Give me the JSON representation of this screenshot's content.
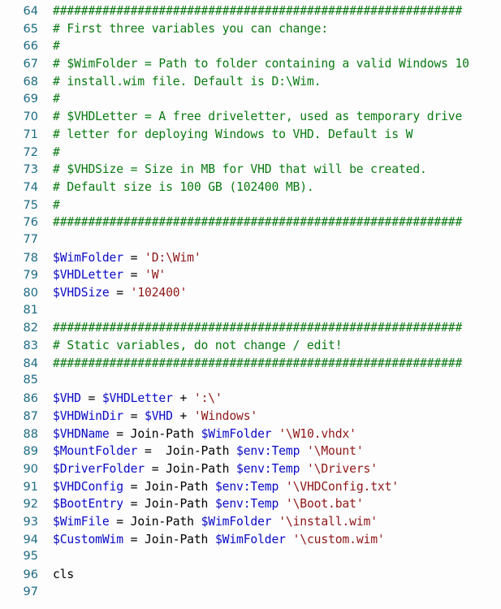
{
  "editor": {
    "language": "PowerShell",
    "background_color": "#fdfdfd",
    "gutter_color": "#1c6a84",
    "colors": {
      "comment": "#0a7a12",
      "variable": "#0a0ac8",
      "string": "#8e1616",
      "plain": "#000000"
    },
    "first_line_number": 64,
    "last_line_number": 97
  },
  "lines": [
    {
      "n": "64",
      "tokens": [
        {
          "t": "comment",
          "s": "##########################################################"
        }
      ]
    },
    {
      "n": "65",
      "tokens": [
        {
          "t": "comment",
          "s": "# First three variables you can change:"
        }
      ]
    },
    {
      "n": "66",
      "tokens": [
        {
          "t": "comment",
          "s": "#"
        }
      ]
    },
    {
      "n": "67",
      "tokens": [
        {
          "t": "comment",
          "s": "# $WimFolder = Path to folder containing a valid Windows 10"
        }
      ]
    },
    {
      "n": "68",
      "tokens": [
        {
          "t": "comment",
          "s": "# install.wim file. Default is D:\\Wim."
        }
      ]
    },
    {
      "n": "69",
      "tokens": [
        {
          "t": "comment",
          "s": "#"
        }
      ]
    },
    {
      "n": "70",
      "tokens": [
        {
          "t": "comment",
          "s": "# $VHDLetter = A free driveletter, used as temporary drive"
        }
      ]
    },
    {
      "n": "71",
      "tokens": [
        {
          "t": "comment",
          "s": "# letter for deploying Windows to VHD. Default is W"
        }
      ]
    },
    {
      "n": "72",
      "tokens": [
        {
          "t": "comment",
          "s": "#"
        }
      ]
    },
    {
      "n": "73",
      "tokens": [
        {
          "t": "comment",
          "s": "# $VHDSize = Size in MB for VHD that will be created."
        }
      ]
    },
    {
      "n": "74",
      "tokens": [
        {
          "t": "comment",
          "s": "# Default size is 100 GB (102400 MB)."
        }
      ]
    },
    {
      "n": "75",
      "tokens": [
        {
          "t": "comment",
          "s": "#"
        }
      ]
    },
    {
      "n": "76",
      "tokens": [
        {
          "t": "comment",
          "s": "##########################################################"
        }
      ]
    },
    {
      "n": "77",
      "tokens": []
    },
    {
      "n": "78",
      "tokens": [
        {
          "t": "var",
          "s": "$WimFolder"
        },
        {
          "t": "plain",
          "s": " = "
        },
        {
          "t": "str",
          "s": "'D:\\Wim'"
        }
      ]
    },
    {
      "n": "79",
      "tokens": [
        {
          "t": "var",
          "s": "$VHDLetter"
        },
        {
          "t": "plain",
          "s": " = "
        },
        {
          "t": "str",
          "s": "'W'"
        }
      ]
    },
    {
      "n": "80",
      "tokens": [
        {
          "t": "var",
          "s": "$VHDSize"
        },
        {
          "t": "plain",
          "s": " = "
        },
        {
          "t": "str",
          "s": "'102400'"
        }
      ]
    },
    {
      "n": "81",
      "tokens": []
    },
    {
      "n": "82",
      "tokens": [
        {
          "t": "comment",
          "s": "##########################################################"
        }
      ]
    },
    {
      "n": "83",
      "tokens": [
        {
          "t": "comment",
          "s": "# Static variables, do not change / edit!"
        }
      ]
    },
    {
      "n": "84",
      "tokens": [
        {
          "t": "comment",
          "s": "##########################################################"
        }
      ]
    },
    {
      "n": "85",
      "tokens": []
    },
    {
      "n": "86",
      "tokens": [
        {
          "t": "var",
          "s": "$VHD"
        },
        {
          "t": "plain",
          "s": " = "
        },
        {
          "t": "var",
          "s": "$VHDLetter"
        },
        {
          "t": "plain",
          "s": " + "
        },
        {
          "t": "str",
          "s": "':\\'"
        }
      ]
    },
    {
      "n": "87",
      "tokens": [
        {
          "t": "var",
          "s": "$VHDWinDir"
        },
        {
          "t": "plain",
          "s": " = "
        },
        {
          "t": "var",
          "s": "$VHD"
        },
        {
          "t": "plain",
          "s": " + "
        },
        {
          "t": "str",
          "s": "'Windows'"
        }
      ]
    },
    {
      "n": "88",
      "tokens": [
        {
          "t": "var",
          "s": "$VHDName"
        },
        {
          "t": "plain",
          "s": " = "
        },
        {
          "t": "cmd",
          "s": "Join-Path "
        },
        {
          "t": "var",
          "s": "$WimFolder"
        },
        {
          "t": "plain",
          "s": " "
        },
        {
          "t": "str",
          "s": "'\\W10.vhdx'"
        }
      ]
    },
    {
      "n": "89",
      "tokens": [
        {
          "t": "var",
          "s": "$MountFolder"
        },
        {
          "t": "plain",
          "s": " =  "
        },
        {
          "t": "cmd",
          "s": "Join-Path "
        },
        {
          "t": "var",
          "s": "$env:Temp"
        },
        {
          "t": "plain",
          "s": " "
        },
        {
          "t": "str",
          "s": "'\\Mount'"
        }
      ]
    },
    {
      "n": "90",
      "tokens": [
        {
          "t": "var",
          "s": "$DriverFolder"
        },
        {
          "t": "plain",
          "s": " = "
        },
        {
          "t": "cmd",
          "s": "Join-Path "
        },
        {
          "t": "var",
          "s": "$env:Temp"
        },
        {
          "t": "plain",
          "s": " "
        },
        {
          "t": "str",
          "s": "'\\Drivers'"
        }
      ]
    },
    {
      "n": "91",
      "tokens": [
        {
          "t": "var",
          "s": "$VHDConfig"
        },
        {
          "t": "plain",
          "s": " = "
        },
        {
          "t": "cmd",
          "s": "Join-Path "
        },
        {
          "t": "var",
          "s": "$env:Temp"
        },
        {
          "t": "plain",
          "s": " "
        },
        {
          "t": "str",
          "s": "'\\VHDConfig.txt'"
        }
      ]
    },
    {
      "n": "92",
      "tokens": [
        {
          "t": "var",
          "s": "$BootEntry"
        },
        {
          "t": "plain",
          "s": " = "
        },
        {
          "t": "cmd",
          "s": "Join-Path "
        },
        {
          "t": "var",
          "s": "$env:Temp"
        },
        {
          "t": "plain",
          "s": " "
        },
        {
          "t": "str",
          "s": "'\\Boot.bat'"
        }
      ]
    },
    {
      "n": "93",
      "tokens": [
        {
          "t": "var",
          "s": "$WimFile"
        },
        {
          "t": "plain",
          "s": " = "
        },
        {
          "t": "cmd",
          "s": "Join-Path "
        },
        {
          "t": "var",
          "s": "$WimFolder"
        },
        {
          "t": "plain",
          "s": " "
        },
        {
          "t": "str",
          "s": "'\\install.wim'"
        }
      ]
    },
    {
      "n": "94",
      "tokens": [
        {
          "t": "var",
          "s": "$CustomWim"
        },
        {
          "t": "plain",
          "s": " = "
        },
        {
          "t": "cmd",
          "s": "Join-Path "
        },
        {
          "t": "var",
          "s": "$WimFolder"
        },
        {
          "t": "plain",
          "s": " "
        },
        {
          "t": "str",
          "s": "'\\custom.wim'"
        }
      ]
    },
    {
      "n": "95",
      "tokens": []
    },
    {
      "n": "96",
      "tokens": [
        {
          "t": "cmd",
          "s": "cls"
        }
      ]
    },
    {
      "n": "97",
      "tokens": []
    }
  ]
}
